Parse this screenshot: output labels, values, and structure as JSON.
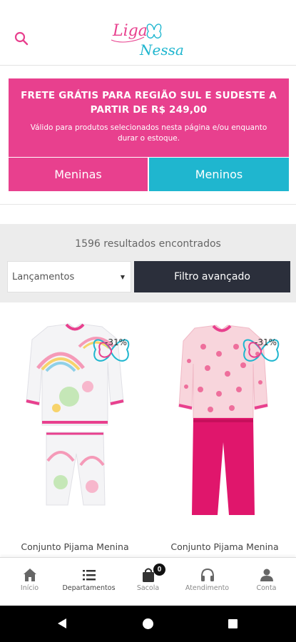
{
  "header": {
    "logo_text_1": "Liga",
    "logo_text_2": "Nessa",
    "logo_colors": {
      "pink": "#e8408e",
      "blue": "#1fb6cf"
    }
  },
  "promo": {
    "title": "FRETE GRÁTIS PARA REGIÃO SUL E SUDESTE A PARTIR DE R$ 249,00",
    "subtitle": "Válido para produtos selecionados nesta página e/ou enquanto durar o estoque.",
    "background": "#e8408e"
  },
  "categories": {
    "girls": "Meninas",
    "boys": "Meninos",
    "girls_color": "#e8408e",
    "boys_color": "#1fb6cf"
  },
  "results": {
    "count_text": "1596 resultados encontrados",
    "sort_selected": "Lançamentos",
    "filter_label": "Filtro avançado"
  },
  "products": [
    {
      "name": "Conjunto Pijama Menina",
      "discount": "-31%",
      "image": "pajama-rainbow-white"
    },
    {
      "name": "Conjunto Pijama Menina",
      "discount": "-31%",
      "image": "pajama-pink-hearts"
    }
  ],
  "bottom_nav": {
    "items": [
      {
        "label": "Início",
        "icon": "home-icon"
      },
      {
        "label": "Departamentos",
        "icon": "menu-icon"
      },
      {
        "label": "Sacola",
        "icon": "bag-icon",
        "badge": "0"
      },
      {
        "label": "Atendimento",
        "icon": "headset-icon"
      },
      {
        "label": "Conta",
        "icon": "user-icon"
      }
    ]
  }
}
